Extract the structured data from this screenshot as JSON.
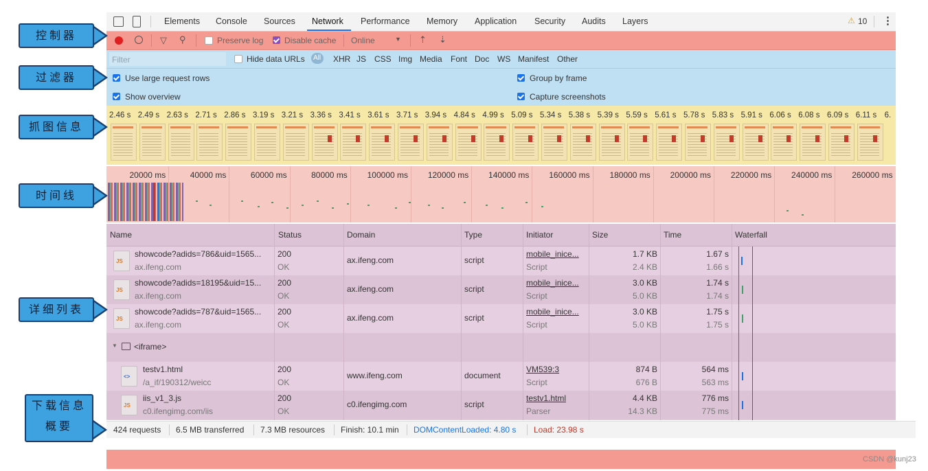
{
  "tabs": {
    "items": [
      "Elements",
      "Console",
      "Sources",
      "Network",
      "Performance",
      "Memory",
      "Application",
      "Security",
      "Audits",
      "Layers"
    ],
    "active": "Network",
    "warning_count": "10"
  },
  "toolbar": {
    "preserve_log": "Preserve log",
    "disable_cache": "Disable cache",
    "throttle": "Online"
  },
  "filter": {
    "placeholder": "Filter",
    "hide_data_urls": "Hide data URLs",
    "types": [
      "All",
      "XHR",
      "JS",
      "CSS",
      "Img",
      "Media",
      "Font",
      "Doc",
      "WS",
      "Manifest",
      "Other"
    ],
    "use_large_rows": "Use large request rows",
    "show_overview": "Show overview",
    "group_by_frame": "Group by frame",
    "capture_screenshots": "Capture screenshots"
  },
  "capture": {
    "times": [
      "2.46 s",
      "2.49 s",
      "2.63 s",
      "2.71 s",
      "2.86 s",
      "3.19 s",
      "3.21 s",
      "3.36 s",
      "3.41 s",
      "3.61 s",
      "3.71 s",
      "3.94 s",
      "4.84 s",
      "4.99 s",
      "5.09 s",
      "5.34 s",
      "5.38 s",
      "5.39 s",
      "5.59 s",
      "5.61 s",
      "5.78 s",
      "5.83 s",
      "5.91 s",
      "6.06 s",
      "6.08 s",
      "6.09 s",
      "6.11 s",
      "6."
    ]
  },
  "timeline": {
    "ticks": [
      "20000 ms",
      "40000 ms",
      "60000 ms",
      "80000 ms",
      "100000 ms",
      "120000 ms",
      "140000 ms",
      "160000 ms",
      "180000 ms",
      "200000 ms",
      "220000 ms",
      "240000 ms",
      "260000 ms"
    ]
  },
  "table": {
    "headers": [
      "Name",
      "Status",
      "Domain",
      "Type",
      "Initiator",
      "Size",
      "Time",
      "Waterfall"
    ],
    "rows": [
      {
        "icon": "JS",
        "name": "showcode?adids=786&uid=1565...",
        "path": "ax.ifeng.com",
        "status": "200",
        "status_text": "OK",
        "domain": "ax.ifeng.com",
        "type": "script",
        "initiator": "mobile_inice...",
        "initiator_type": "Script",
        "size": "1.7 KB",
        "size2": "2.4 KB",
        "time": "1.67 s",
        "time2": "1.66 s"
      },
      {
        "icon": "JS",
        "name": "showcode?adids=18195&uid=15...",
        "path": "ax.ifeng.com",
        "status": "200",
        "status_text": "OK",
        "domain": "ax.ifeng.com",
        "type": "script",
        "initiator": "mobile_inice...",
        "initiator_type": "Script",
        "size": "3.0 KB",
        "size2": "5.0 KB",
        "time": "1.74 s",
        "time2": "1.74 s"
      },
      {
        "icon": "JS",
        "name": "showcode?adids=787&uid=1565...",
        "path": "ax.ifeng.com",
        "status": "200",
        "status_text": "OK",
        "domain": "ax.ifeng.com",
        "type": "script",
        "initiator": "mobile_inice...",
        "initiator_type": "Script",
        "size": "3.0 KB",
        "size2": "5.0 KB",
        "time": "1.75 s",
        "time2": "1.75 s"
      }
    ],
    "group_label": "<iframe>",
    "group_rows": [
      {
        "icon": "<>",
        "name": "testv1.html",
        "path": "/a_if/190312/weicc",
        "status": "200",
        "status_text": "OK",
        "domain": "www.ifeng.com",
        "type": "document",
        "initiator": "VM539:3",
        "initiator_type": "Script",
        "size": "874 B",
        "size2": "676 B",
        "time": "564 ms",
        "time2": "563 ms"
      },
      {
        "icon": "JS",
        "name": "iis_v1_3.js",
        "path": "c0.ifengimg.com/iis",
        "status": "200",
        "status_text": "OK",
        "domain": "c0.ifengimg.com",
        "type": "script",
        "initiator": "testv1.html",
        "initiator_type": "Parser",
        "size": "4.4 KB",
        "size2": "14.3 KB",
        "time": "776 ms",
        "time2": "775 ms"
      }
    ]
  },
  "summary": {
    "requests": "424 requests",
    "transferred": "6.5 MB transferred",
    "resources": "7.3 MB resources",
    "finish": "Finish: 10.1 min",
    "dcl": "DOMContentLoaded: 4.80 s",
    "load": "Load: 23.98 s"
  },
  "callouts": {
    "controls": "控制器",
    "filters": "过滤器",
    "capture": "抓图信息",
    "timeline": "时间线",
    "details": "详细列表",
    "summary_line1": "下载信息",
    "summary_line2": "概要"
  },
  "watermark": "CSDN @kunj23",
  "colors": {
    "toolbar": "#f49a90",
    "filters": "#bfdff2",
    "capture": "#f6e8a6",
    "timeline": "#f6c9c3",
    "table": "#e6cfe0",
    "callout": "#3fa2e0",
    "dcl": "#1a73e8",
    "load": "#c0392b"
  }
}
